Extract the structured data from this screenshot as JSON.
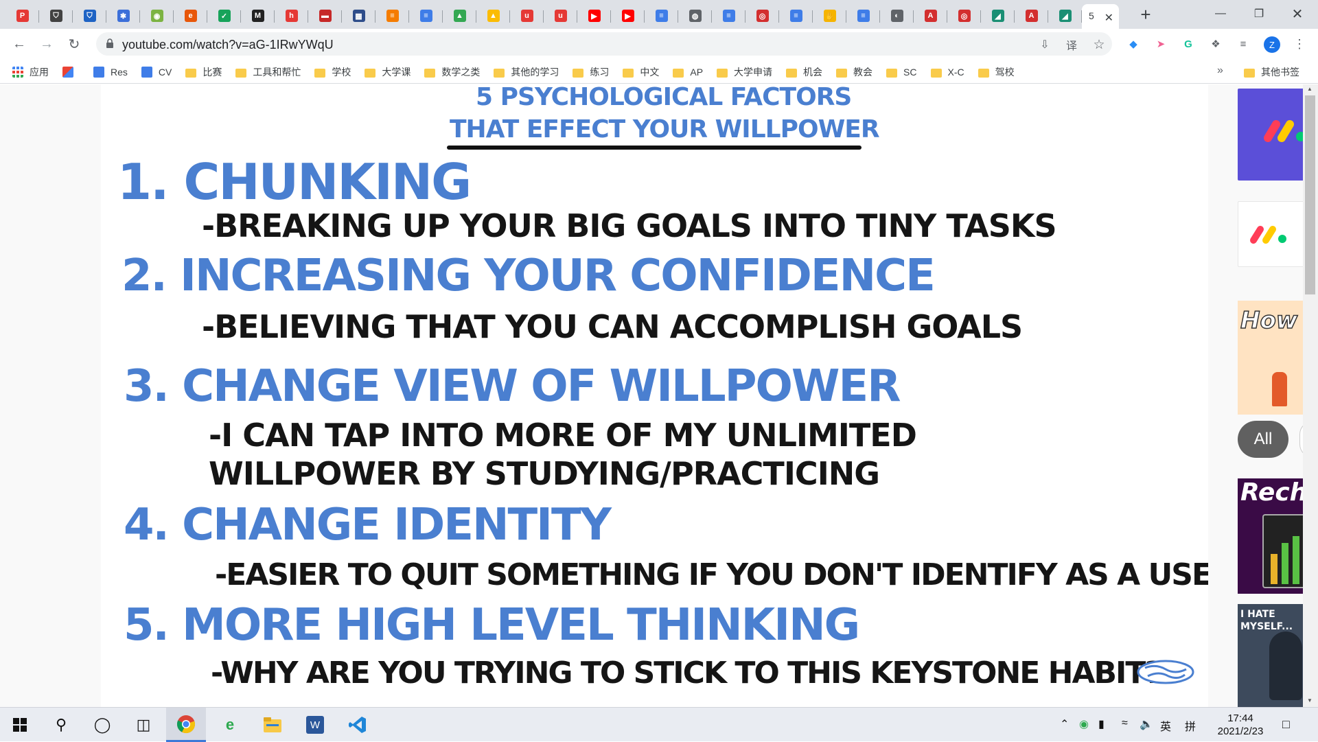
{
  "browser": {
    "tabs": [
      {
        "icon": "pdf-icon",
        "color": "#e53935",
        "glyph": "P"
      },
      {
        "icon": "shield-icon",
        "color": "#424242",
        "glyph": "⛉"
      },
      {
        "icon": "shield-blue-icon",
        "color": "#1e63c4",
        "glyph": "⛉"
      },
      {
        "icon": "sparkle-icon",
        "color": "#3c6fd9",
        "glyph": "✱"
      },
      {
        "icon": "circle-green-icon",
        "color": "#7cb342",
        "glyph": "◉"
      },
      {
        "icon": "edu-icon",
        "color": "#e8570a",
        "glyph": "e"
      },
      {
        "icon": "check-shield-icon",
        "color": "#17a35a",
        "glyph": "✓"
      },
      {
        "icon": "math-icon",
        "color": "#222222",
        "glyph": "M"
      },
      {
        "icon": "h-icon",
        "color": "#e53935",
        "glyph": "h"
      },
      {
        "icon": "red-badge-icon",
        "color": "#c62828",
        "glyph": "▬"
      },
      {
        "icon": "calendar-icon",
        "color": "#2e4d8a",
        "glyph": "▦"
      },
      {
        "icon": "orange-doc-icon",
        "color": "#f57c00",
        "glyph": "≡"
      },
      {
        "icon": "docs-icon",
        "color": "#3f7de8",
        "glyph": "≡"
      },
      {
        "icon": "drive-icon",
        "color": "#34a853",
        "glyph": "▲"
      },
      {
        "icon": "drive-icon",
        "color": "#fbbc04",
        "glyph": "▲"
      },
      {
        "icon": "u-red-icon",
        "color": "#e53935",
        "glyph": "u"
      },
      {
        "icon": "u-red-icon",
        "color": "#e53935",
        "glyph": "u"
      },
      {
        "icon": "youtube-icon",
        "color": "#ff0000",
        "glyph": "▶"
      },
      {
        "icon": "youtube-icon",
        "color": "#ff0000",
        "glyph": "▶"
      },
      {
        "icon": "docs-icon",
        "color": "#3f7de8",
        "glyph": "≡"
      },
      {
        "icon": "mic-icon",
        "color": "#5f6368",
        "glyph": "◍"
      },
      {
        "icon": "docs-icon",
        "color": "#3f7de8",
        "glyph": "≡"
      },
      {
        "icon": "red-ring-icon",
        "color": "#d32f2f",
        "glyph": "◎"
      },
      {
        "icon": "docs-icon",
        "color": "#3f7de8",
        "glyph": "≡"
      },
      {
        "icon": "hand-icon",
        "color": "#f6b400",
        "glyph": "✋"
      },
      {
        "icon": "docs-icon",
        "color": "#3f7de8",
        "glyph": "≡"
      },
      {
        "icon": "globe-icon",
        "color": "#5f6368",
        "glyph": "◐"
      },
      {
        "icon": "font-a-icon",
        "color": "#d32f2f",
        "glyph": "A"
      },
      {
        "icon": "red-ring-icon",
        "color": "#d32f2f",
        "glyph": "◎"
      },
      {
        "icon": "chart-icon",
        "color": "#1a8f74",
        "glyph": "◢"
      },
      {
        "icon": "font-a-icon",
        "color": "#d32f2f",
        "glyph": "A"
      },
      {
        "icon": "chart-icon",
        "color": "#1a8f74",
        "glyph": "◢"
      }
    ],
    "active_tab_partial_title": "5",
    "url": "youtube.com/watch?v=aG-1IRwYWqU",
    "profile_initial": "Z"
  },
  "bookmarks": {
    "apps_label": "应用",
    "items": [
      {
        "label": "",
        "type": "gmail"
      },
      {
        "label": "Res",
        "type": "doc"
      },
      {
        "label": "CV",
        "type": "doc"
      },
      {
        "label": "比赛",
        "type": "folder"
      },
      {
        "label": "工具和帮忙",
        "type": "folder"
      },
      {
        "label": "学校",
        "type": "folder"
      },
      {
        "label": "大学课",
        "type": "folder"
      },
      {
        "label": "数学之类",
        "type": "folder"
      },
      {
        "label": "其他的学习",
        "type": "folder"
      },
      {
        "label": "练习",
        "type": "folder"
      },
      {
        "label": "中文",
        "type": "folder"
      },
      {
        "label": "AP",
        "type": "folder"
      },
      {
        "label": "大学申请",
        "type": "folder"
      },
      {
        "label": "机会",
        "type": "folder"
      },
      {
        "label": "教会",
        "type": "folder"
      },
      {
        "label": "SC",
        "type": "folder"
      },
      {
        "label": "X-C",
        "type": "folder"
      },
      {
        "label": "驾校",
        "type": "folder"
      }
    ],
    "more_label": "»",
    "other_label": "其他书签"
  },
  "video": {
    "title_line1": "5 PSYCHOLOGICAL FACTORS",
    "title_line2": "THAT EFFECT YOUR WILLPOWER",
    "factor1": "1. CHUNKING",
    "factor1_desc": "-BREAKING UP YOUR BIG GOALS INTO TINY TASKS",
    "factor2": "2. INCREASING YOUR CONFIDENCE",
    "factor2_desc": "-BELIEVING THAT YOU CAN ACCOMPLISH GOALS",
    "factor3": "3. CHANGE VIEW OF WILLPOWER",
    "factor3_desc1": "-I CAN TAP INTO MORE OF MY UNLIMITED",
    "factor3_desc2": "WILLPOWER BY STUDYING/PRACTICING",
    "factor4": "4. CHANGE IDENTITY",
    "factor4_desc": "-EASIER TO QUIT SOMETHING IF YOU DON'T IDENTIFY AS A USER",
    "factor5": "5. MORE HIGH LEVEL THINKING",
    "factor5_desc": "-WHY ARE YOU TRYING TO STICK TO THIS KEYSTONE HABIT?"
  },
  "recommendations": {
    "chip_all": "All",
    "thumb3_text": "How t Sel",
    "thumb4_text": "Rech",
    "thumb5_text": "I HATE MYSELF..."
  },
  "taskbar": {
    "time": "17:44",
    "date": "2021/2/23",
    "ime_lang": "英",
    "ime_mode": "拼"
  }
}
